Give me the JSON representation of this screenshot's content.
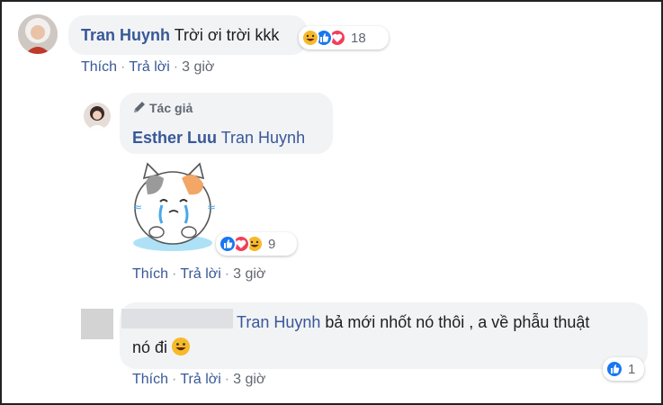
{
  "comment1": {
    "author": "Tran Huynh",
    "text": "Trời ơi trời kkk",
    "reaction_count": "18",
    "actions": {
      "like": "Thích",
      "reply": "Trả lời",
      "time": "3 giờ"
    }
  },
  "reply1": {
    "badge": "Tác giả",
    "author": "Esther Luu",
    "mention": "Tran Huynh",
    "sticker": "crying-cat-sticker",
    "reaction_count": "9",
    "actions": {
      "like": "Thích",
      "reply": "Trả lời",
      "time": "3 giờ"
    }
  },
  "reply2": {
    "mention": "Tran Huynh",
    "text_line1": "bả mới nhốt nó thôi , a về phẫu thuật",
    "text_line2": "nó đi",
    "reaction_count": "1",
    "actions": {
      "like": "Thích",
      "reply": "Trả lời",
      "time": "3 giờ"
    }
  },
  "colors": {
    "link": "#385898",
    "bubble": "#f2f3f5",
    "like": "#1877f2",
    "love": "#f33e58",
    "haha": "#f7b928"
  }
}
